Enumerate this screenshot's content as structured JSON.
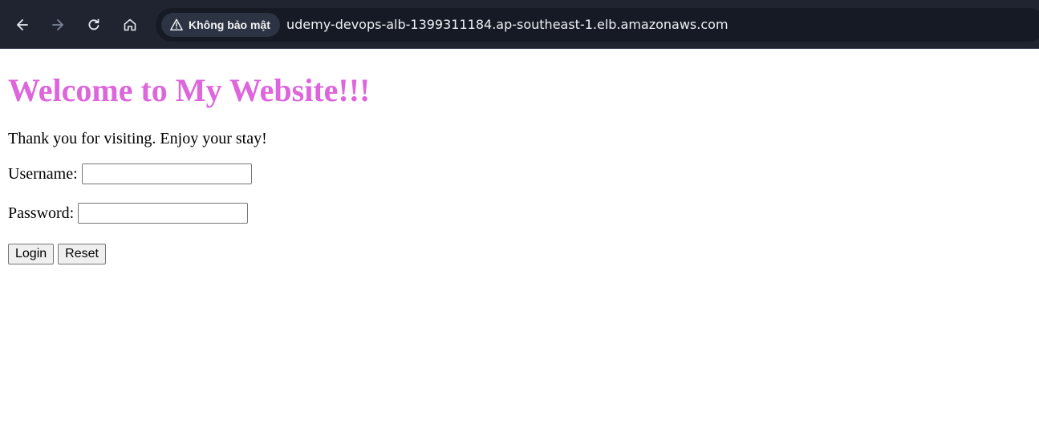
{
  "browser": {
    "security_label": "Không bảo mật",
    "url": "udemy-devops-alb-1399311184.ap-southeast-1.elb.amazonaws.com",
    "icons": [
      "back-arrow-icon",
      "forward-arrow-icon",
      "reload-icon",
      "home-icon",
      "warning-triangle-icon"
    ]
  },
  "page": {
    "heading": "Welcome to My Website!!!",
    "heading_color": "#dd66dd",
    "intro": "Thank you for visiting. Enjoy your stay!",
    "form": {
      "username_label": "Username:",
      "username_value": "",
      "password_label": "Password:",
      "password_value": "",
      "login_label": "Login",
      "reset_label": "Reset"
    }
  }
}
